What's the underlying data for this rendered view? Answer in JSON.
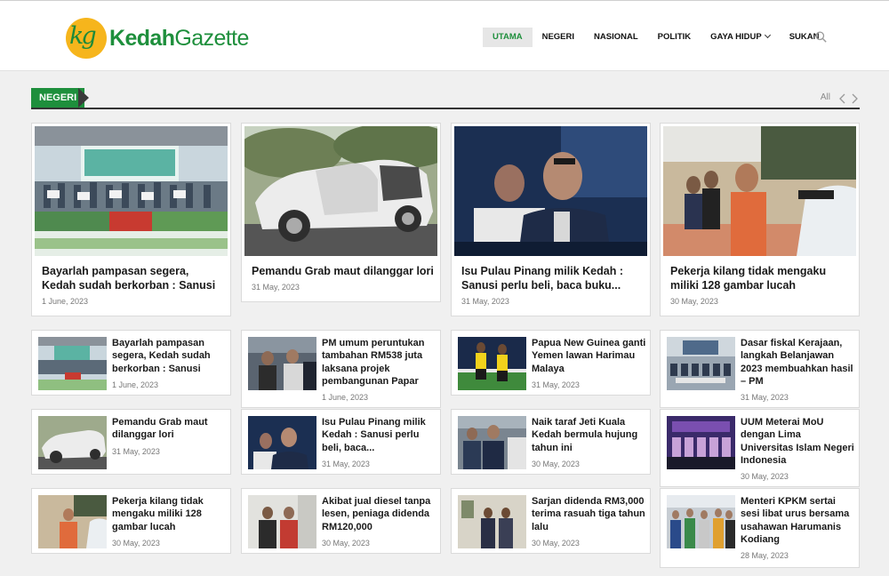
{
  "site": {
    "logo_mark": "kg",
    "logo_bold": "Kedah",
    "logo_light": "Gazette"
  },
  "nav": {
    "items": [
      "UTAMA",
      "NEGERI",
      "NASIONAL",
      "POLITIK",
      "GAYA HIDUP",
      "SUKAN"
    ],
    "active": "UTAMA"
  },
  "section": {
    "tab": "NEGERI",
    "all_label": "All"
  },
  "featured": [
    {
      "title": "Bayarlah pampasan segera, Kedah sudah berkorban : Sanusi",
      "date": "1 June, 2023"
    },
    {
      "title": "Pemandu Grab maut dilanggar lori",
      "date": "31 May, 2023"
    },
    {
      "title": "Isu Pulau Pinang milik Kedah : Sanusi perlu beli, baca buku...",
      "date": "31 May, 2023"
    },
    {
      "title": "Pekerja kilang tidak mengaku miliki 128 gambar lucah",
      "date": "30 May, 2023"
    }
  ],
  "columns": [
    [
      {
        "title": "Bayarlah pampasan segera, Kedah sudah berkorban : Sanusi",
        "date": "1 June, 2023"
      },
      {
        "title": "Pemandu Grab maut dilanggar lori",
        "date": "31 May, 2023"
      },
      {
        "title": "Pekerja kilang tidak mengaku miliki 128 gambar lucah",
        "date": "30 May, 2023"
      }
    ],
    [
      {
        "title": "PM umum peruntukan tambahan RM538 juta laksana projek pembangunan Papar",
        "date": "1 June, 2023"
      },
      {
        "title": "Isu Pulau Pinang milik Kedah : Sanusi perlu beli, baca...",
        "date": "31 May, 2023"
      },
      {
        "title": "Akibat jual diesel tanpa lesen, peniaga didenda RM120,000",
        "date": "30 May, 2023"
      }
    ],
    [
      {
        "title": "Papua New Guinea ganti Yemen lawan Harimau Malaya",
        "date": "31 May, 2023"
      },
      {
        "title": "Naik taraf Jeti Kuala Kedah bermula hujung tahun ini",
        "date": "30 May, 2023"
      },
      {
        "title": "Sarjan didenda RM3,000 terima rasuah tiga tahun lalu",
        "date": "30 May, 2023"
      }
    ],
    [
      {
        "title": "Dasar fiskal Kerajaan, langkah Belanjawan 2023 membuahkan hasil – PM",
        "date": "31 May, 2023"
      },
      {
        "title": "UUM Meterai MoU dengan Lima Universitas Islam Negeri Indonesia",
        "date": "30 May, 2023"
      },
      {
        "title": "Menteri KPKM sertai sesi libat urus bersama usahawan Harumanis Kodiang",
        "date": "28 May, 2023"
      }
    ]
  ],
  "colors": {
    "brand_green": "#1e8f3c",
    "logo_yellow": "#f6b51c",
    "section_rule": "#333333"
  }
}
